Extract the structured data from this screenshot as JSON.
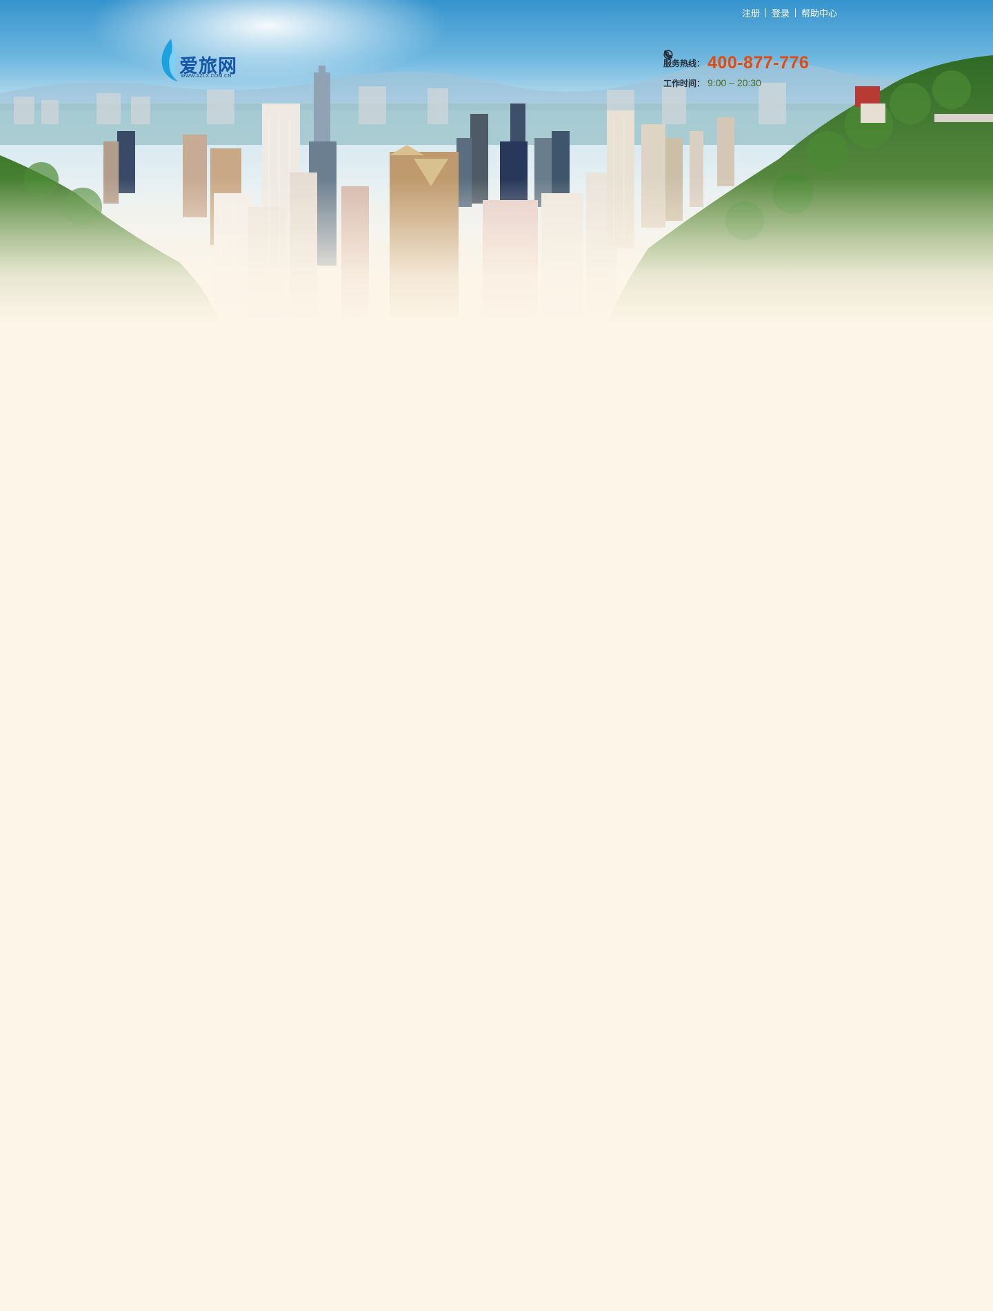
{
  "header": {
    "top_links": [
      {
        "label": "注册"
      },
      {
        "label": "登录"
      },
      {
        "label": "帮助中心"
      }
    ],
    "logo": {
      "name": "爱旅网",
      "url_text": "WWW.AZLX.COM.CN"
    },
    "contact": {
      "hotline_label": "服务热线：",
      "hotline_number": "400-877-776",
      "hours_label": "工作时间：",
      "hours_value": "9:00 – 20:30"
    }
  },
  "colors": {
    "page_background": "#fdf5e8",
    "sky": "#3a9bd1",
    "hotline": "#e14a10",
    "hours": "#4c6a1e",
    "logo_blue": "#1656a8"
  },
  "icons": {
    "phone": "phone-icon",
    "clock": "clock-icon",
    "flame": "flame-logo-icon"
  }
}
